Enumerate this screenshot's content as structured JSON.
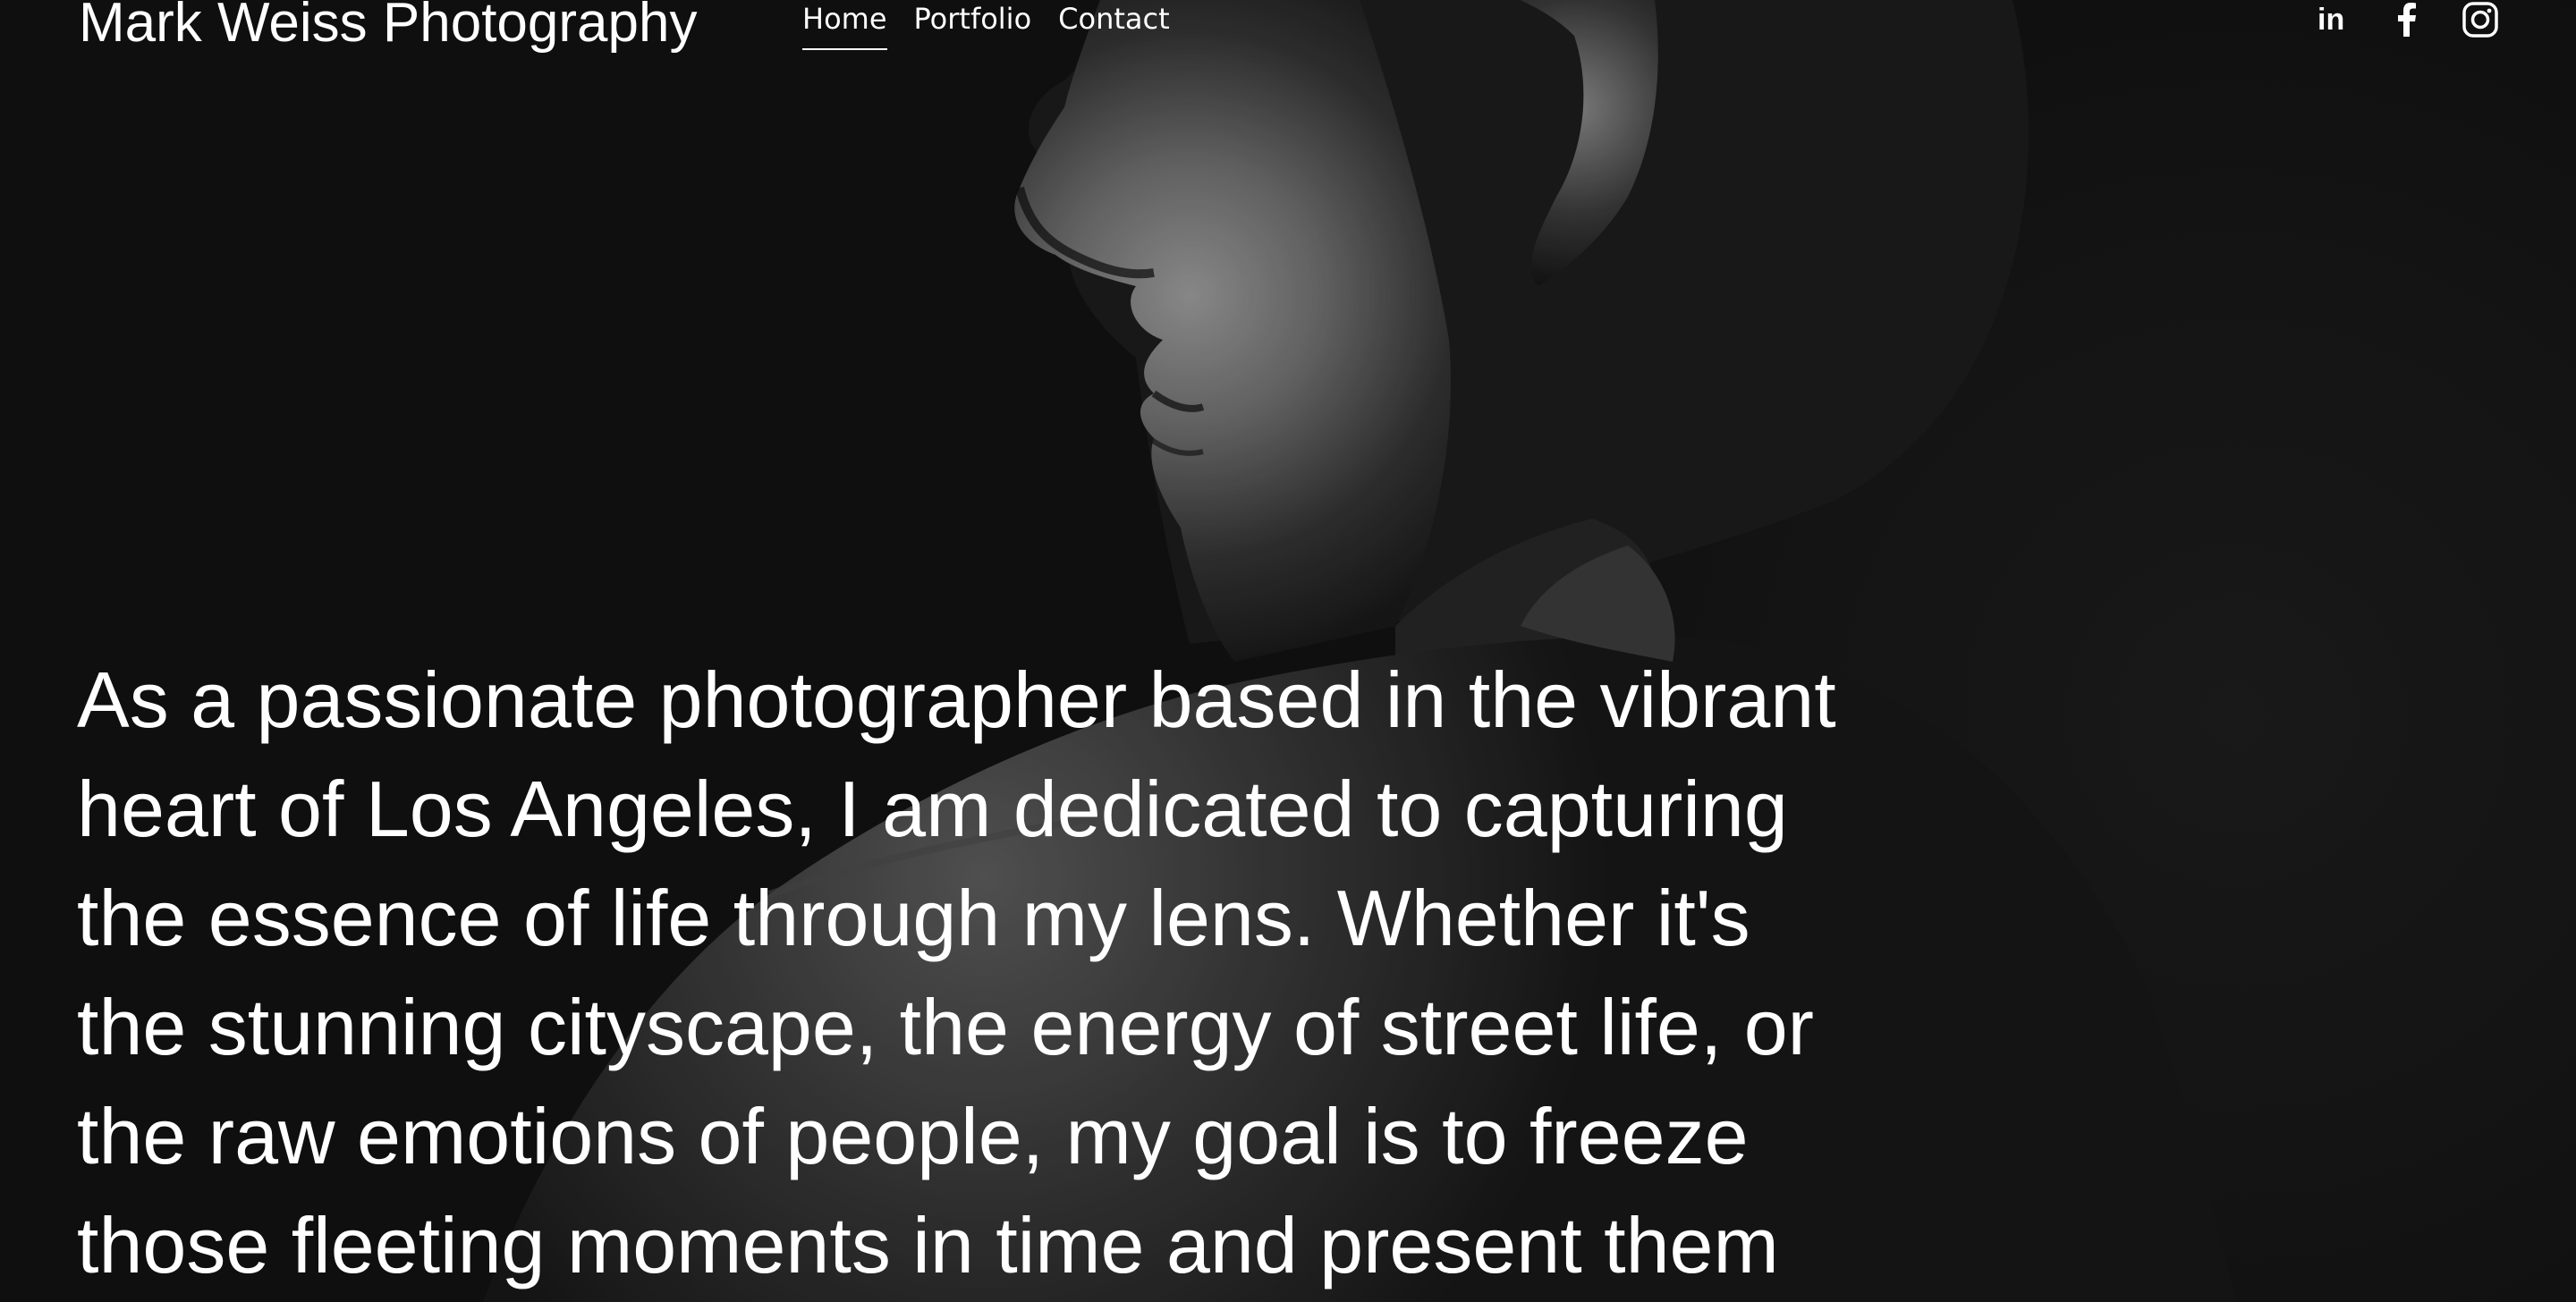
{
  "site": {
    "title": "Mark Weiss Photography"
  },
  "nav": {
    "items": [
      {
        "label": "Home",
        "active": true
      },
      {
        "label": "Portfolio",
        "active": false
      },
      {
        "label": "Contact",
        "active": false
      }
    ]
  },
  "social": {
    "icons": [
      "linkedin-icon",
      "facebook-icon",
      "instagram-icon"
    ],
    "linkedin_label": "in"
  },
  "hero": {
    "background_color": "#121212",
    "image_subject": "black-and-white profile portrait"
  },
  "intro": {
    "lines": [
      "As a passionate photographer based in the vibrant",
      "heart of Los Angeles, I am dedicated to capturing",
      "the essence of life through my lens. Whether it's",
      "the stunning cityscape, the energy of street life, or",
      "the raw emotions of people, my goal is to freeze",
      "those fleeting moments in time and present them"
    ]
  }
}
